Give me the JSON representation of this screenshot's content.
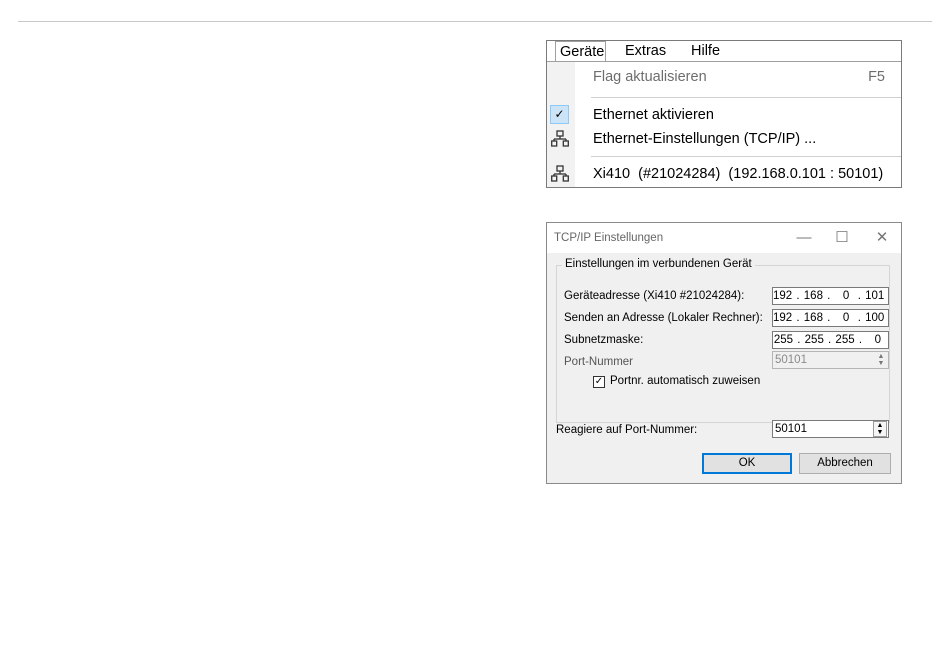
{
  "menu": {
    "bar": [
      "Geräte",
      "Extras",
      "Hilfe"
    ],
    "items": [
      {
        "label": "Flag aktualisieren",
        "shortcut": "F5",
        "icon": "none",
        "state": "disabled"
      },
      {
        "label": "Ethernet aktivieren",
        "icon": "checkmark-icon",
        "checked": true
      },
      {
        "label": "Ethernet-Einstellungen (TCP/IP) ...",
        "icon": "network-icon"
      },
      {
        "label": "Xi410  (#21024284)  (192.168.0.101 : 50101)",
        "icon": "network-icon"
      }
    ]
  },
  "dialog": {
    "title": "TCP/IP Einstellungen",
    "titlebar_buttons": {
      "minimize": "—",
      "maximize": "☐",
      "close": "✕"
    },
    "group_title": "Einstellungen im verbundenen Gerät",
    "fields": {
      "device_address": {
        "label": "Geräteadresse (Xi410 #21024284):",
        "value": "192 . 168 .   0  . 101"
      },
      "send_address": {
        "label": "Senden an Adresse (Lokaler Rechner):",
        "value": "192 . 168 .   0  . 100"
      },
      "subnet": {
        "label": "Subnetzmaske:",
        "value": "255 . 255 . 255 .   0"
      },
      "port": {
        "label": "Port-Nummer",
        "value": "50101"
      }
    },
    "auto_port": {
      "label": "Portnr. automatisch zuweisen",
      "checked": true,
      "mark": "✓"
    },
    "react_port": {
      "label": "Reagiere auf Port-Nummer:",
      "value": "50101"
    },
    "buttons": {
      "ok": "OK",
      "cancel": "Abbrechen"
    },
    "spinner_arrows": {
      "up": "▲",
      "down": "▼"
    }
  },
  "colors": {
    "accent": "#0078d7",
    "check_bg": "#cce4f7"
  }
}
